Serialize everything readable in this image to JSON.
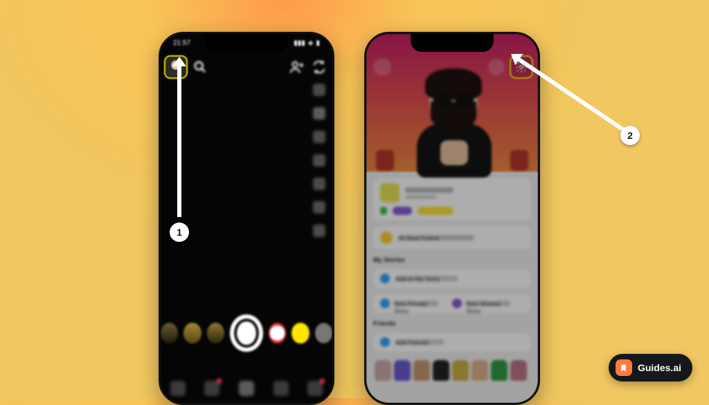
{
  "statusbar": {
    "time": "21:57"
  },
  "callouts": {
    "step1": "1",
    "step2": "2"
  },
  "profile": {
    "sections": {
      "stories": "My Stories",
      "friends": "Friends"
    },
    "rows": {
      "addStory": "Add to My Story",
      "privateStory": "New Private Story",
      "sharedStory": "New Shared Story",
      "addFriends": "Add Friends",
      "bestFriend": "#1 Best Friend"
    }
  },
  "watermark": {
    "label": "Guides.ai"
  }
}
